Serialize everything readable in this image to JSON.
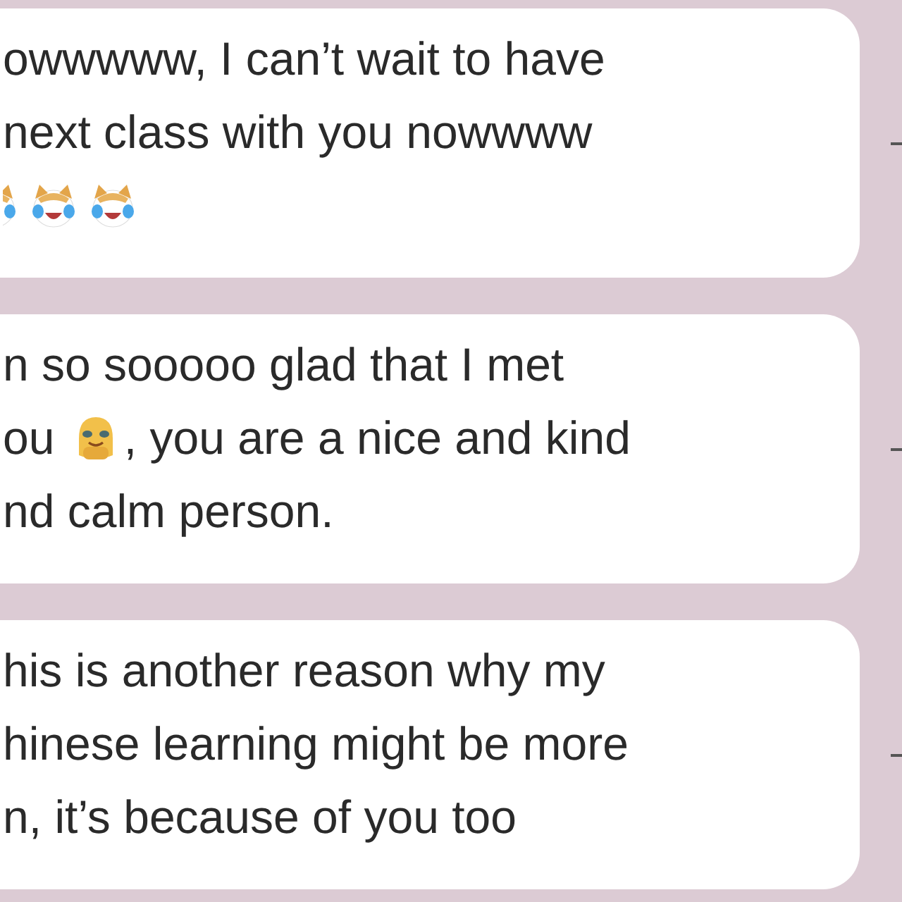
{
  "messages": [
    {
      "lines": [
        {
          "segments": [
            {
              "kind": "text",
              "text": "owwwww, I can’t wait to have"
            }
          ]
        },
        {
          "segments": [
            {
              "kind": "text",
              "text": "next class with you nowwww"
            }
          ]
        },
        {
          "segments": [
            {
              "kind": "cat_cut"
            },
            {
              "kind": "cat"
            },
            {
              "kind": "cat"
            }
          ]
        }
      ]
    },
    {
      "lines": [
        {
          "segments": [
            {
              "kind": "text",
              "text": "n so sooooo glad that I met"
            }
          ]
        },
        {
          "segments": [
            {
              "kind": "text",
              "text": "ou "
            },
            {
              "kind": "hug"
            },
            {
              "kind": "text",
              "text": ", you are a nice and kind"
            }
          ]
        },
        {
          "segments": [
            {
              "kind": "text",
              "text": "nd calm person."
            }
          ]
        }
      ]
    },
    {
      "lines": [
        {
          "segments": [
            {
              "kind": "text",
              "text": "his is another reason why my"
            }
          ]
        },
        {
          "segments": [
            {
              "kind": "text",
              "text": "hinese learning might be more"
            }
          ]
        },
        {
          "segments": [
            {
              "kind": "text",
              "text": "n, it’s because of you too"
            }
          ]
        }
      ]
    }
  ]
}
